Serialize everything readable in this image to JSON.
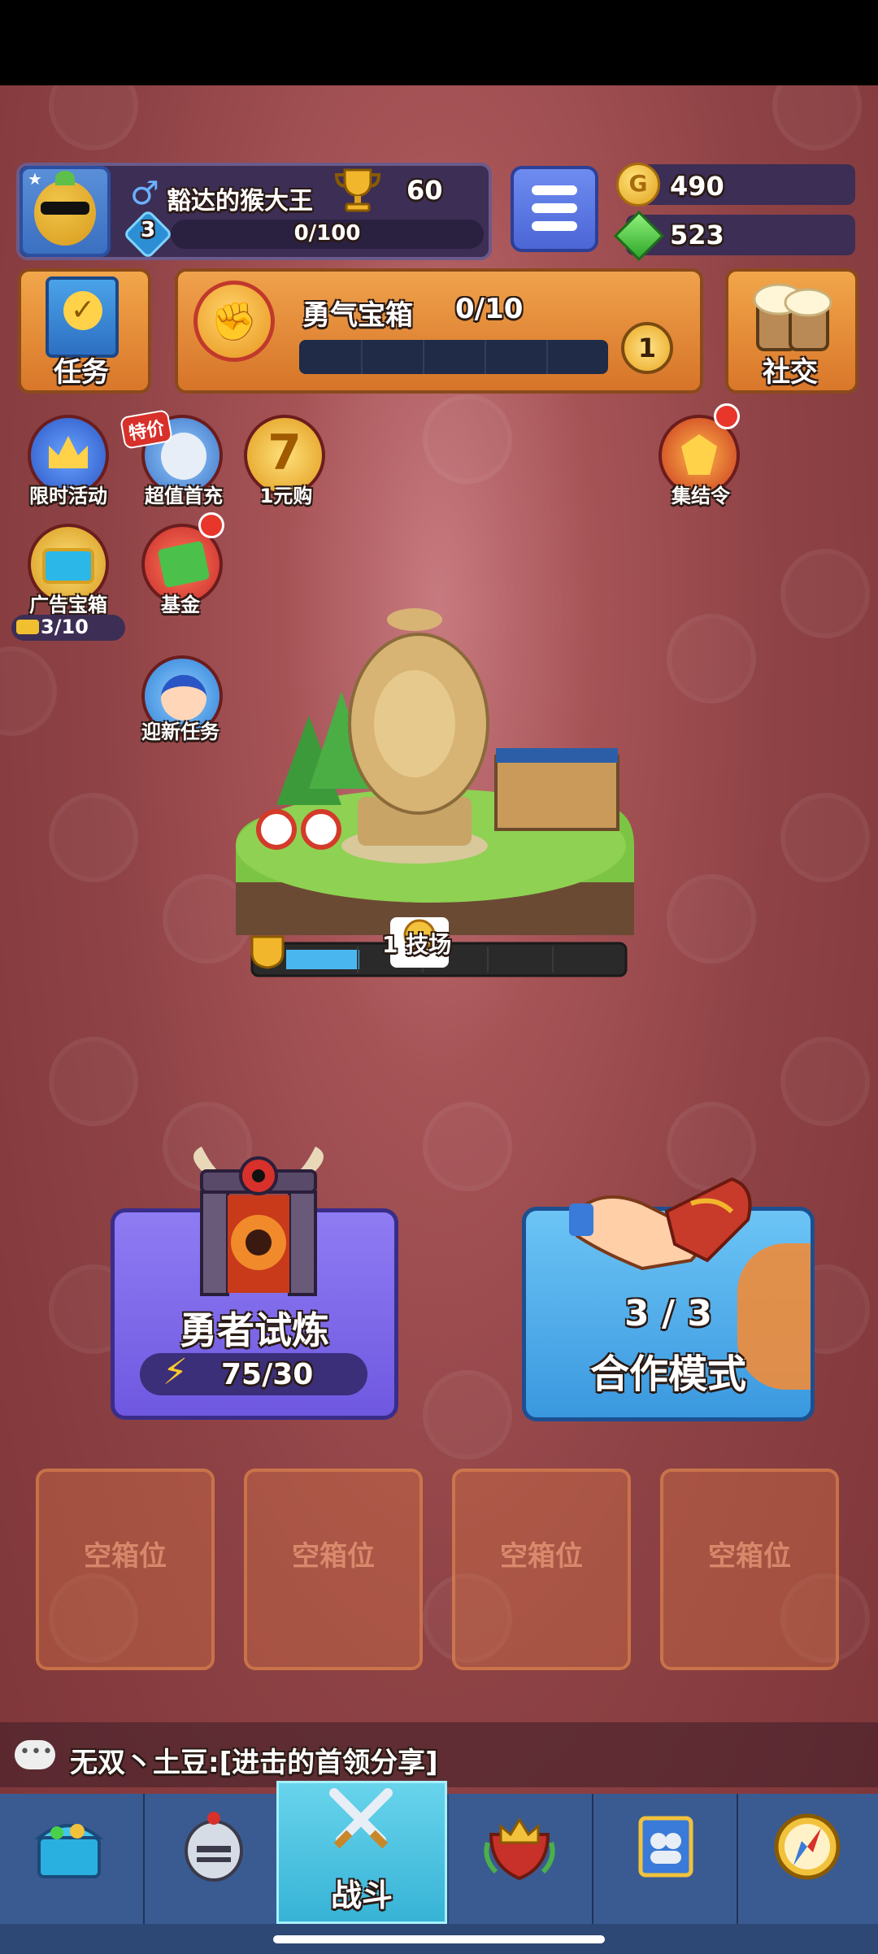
{
  "player": {
    "name": "豁达的猴大王",
    "gender_icon": "♂",
    "trophies": "60",
    "level": "3",
    "xp": "0/100"
  },
  "currency": {
    "coins": "490",
    "gems": "523"
  },
  "buttons": {
    "tasks": "任务",
    "social": "社交"
  },
  "courage_chest": {
    "title": "勇气宝箱",
    "progress": "0/10",
    "progress_fraction": 0,
    "keys": "1"
  },
  "shortcuts": {
    "limited_event": "限时活动",
    "first_recharge": "超值首充",
    "first_recharge_tag": "特价",
    "one_yuan": "1元购",
    "one_yuan_glyph": "7",
    "rally": "集结令",
    "ad_chest": "广告宝箱",
    "ad_chest_count": "3/10",
    "fund": "基金",
    "newcomer_tasks": "迎新任务"
  },
  "arena": {
    "label": "1  技场",
    "trophy_progress_fraction": 0.2
  },
  "modes": {
    "trial": {
      "title": "勇者试炼",
      "energy": "75/30"
    },
    "coop": {
      "count": "3 / 3",
      "title": "合作模式"
    }
  },
  "chest_slots": [
    "空箱位",
    "空箱位",
    "空箱位",
    "空箱位"
  ],
  "chat": {
    "message": "无双丶土豆:[进击的首领分享]"
  },
  "nav": {
    "active_label": "战斗",
    "tabs": [
      "shop-chest-icon",
      "knight-helmet-icon",
      "crossed-swords-icon",
      "crown-shield-icon",
      "guild-banner-icon",
      "compass-icon"
    ]
  },
  "colors": {
    "background": "#8a3d40",
    "nav_bg": "#2e4876",
    "nav_active": "#37b3d6",
    "trial_purple": "#6f58e0",
    "coop_blue": "#3a98df",
    "orange_button": "#d9772a"
  }
}
